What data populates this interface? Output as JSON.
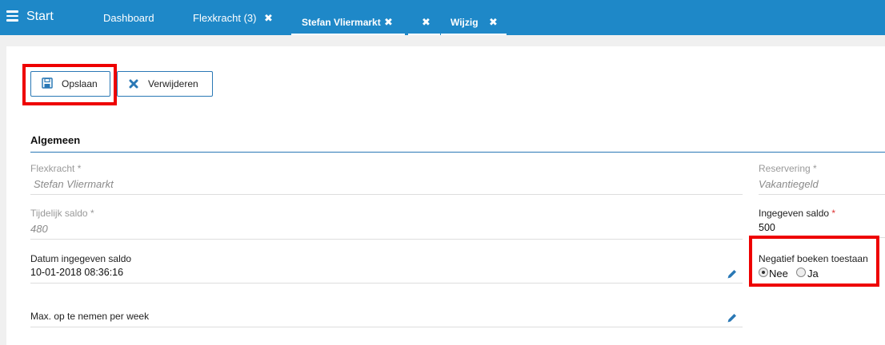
{
  "header": {
    "start": "Start",
    "tabs": [
      {
        "label": "Dashboard"
      },
      {
        "label": "Flexkracht (3)"
      },
      {
        "label": "Stefan Vliermarkt"
      },
      {
        "label": ""
      },
      {
        "label": "Wijzig"
      }
    ],
    "close_glyph": "✖"
  },
  "toolbar": {
    "save_label": "Opslaan",
    "delete_label": "Verwijderen"
  },
  "section": {
    "title": "Algemeen"
  },
  "fields": {
    "flexkracht": {
      "label": "Flexkracht",
      "required": "*",
      "value": "Stefan Vliermarkt"
    },
    "reservering": {
      "label": "Reservering",
      "required": "*",
      "value": "Vakantiegeld"
    },
    "tijdelijk_saldo": {
      "label": "Tijdelijk saldo",
      "required": "*",
      "value": "480"
    },
    "ingegeven_saldo": {
      "label": "Ingegeven saldo",
      "required": "*",
      "value": "500"
    },
    "datum_ingegeven_saldo": {
      "label": "Datum ingegeven saldo",
      "value": "10-01-2018 08:36:16"
    },
    "negatief_boeken": {
      "label": "Negatief boeken toestaan",
      "options": [
        "Nee",
        "Ja"
      ],
      "selected": "Nee"
    },
    "max_per_week": {
      "label": "Max. op te nemen per week"
    }
  },
  "colors": {
    "topbar": "#1e88c8",
    "accent": "#2a78b5",
    "highlight": "#e00000",
    "required": "#d33333"
  }
}
